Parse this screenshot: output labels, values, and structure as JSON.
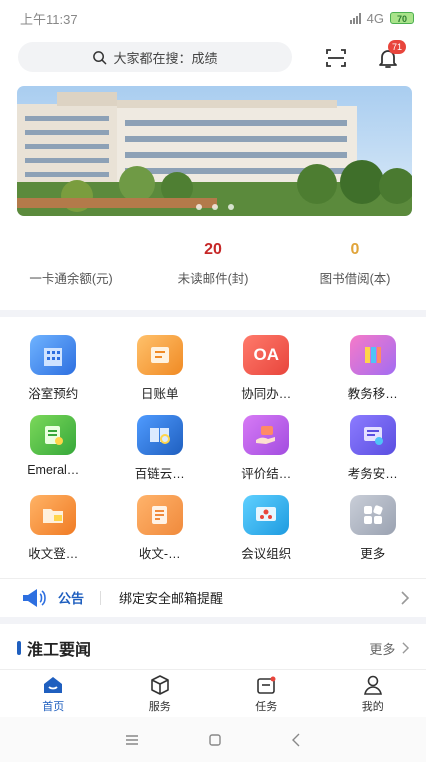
{
  "status": {
    "time": "上午11:37",
    "network": "4G",
    "battery": "70"
  },
  "header": {
    "search_placeholder": "大家都在搜：成绩",
    "notification_count": "71"
  },
  "banner": {
    "slide_count": 3,
    "active_index": 1
  },
  "stats": [
    {
      "value": "",
      "label": "一卡通余额(元)",
      "color": "#c62828"
    },
    {
      "value": "20",
      "label": "未读邮件(封)",
      "color": "#c62828"
    },
    {
      "value": "0",
      "label": "图书借阅(本)",
      "color": "#e0a43a"
    }
  ],
  "services": [
    {
      "label": "浴室预约",
      "icon": "building-icon"
    },
    {
      "label": "日账单",
      "icon": "bill-icon"
    },
    {
      "label": "协同办…",
      "icon": "oa-icon",
      "icon_text": "OA"
    },
    {
      "label": "教务移…",
      "icon": "books-icon"
    },
    {
      "label": "Emeral…",
      "icon": "document-icon"
    },
    {
      "label": "百链云…",
      "icon": "book-search-icon"
    },
    {
      "label": "评价结…",
      "icon": "hand-card-icon"
    },
    {
      "label": "考务安…",
      "icon": "exam-icon"
    },
    {
      "label": "收文登…",
      "icon": "folder-icon"
    },
    {
      "label": "收文-…",
      "icon": "notepad-icon"
    },
    {
      "label": "会议组织",
      "icon": "meeting-icon"
    },
    {
      "label": "更多",
      "icon": "more-grid-icon"
    }
  ],
  "notice": {
    "tag": "公告",
    "text": "绑定安全邮箱提醒"
  },
  "news": {
    "title": "淮工要闻",
    "more": "更多"
  },
  "tabs": [
    {
      "label": "首页",
      "active": true
    },
    {
      "label": "服务",
      "active": false
    },
    {
      "label": "任务",
      "active": false
    },
    {
      "label": "我的",
      "active": false
    }
  ],
  "colors": {
    "accent": "#1f5fbf",
    "badge": "#e8453c"
  }
}
